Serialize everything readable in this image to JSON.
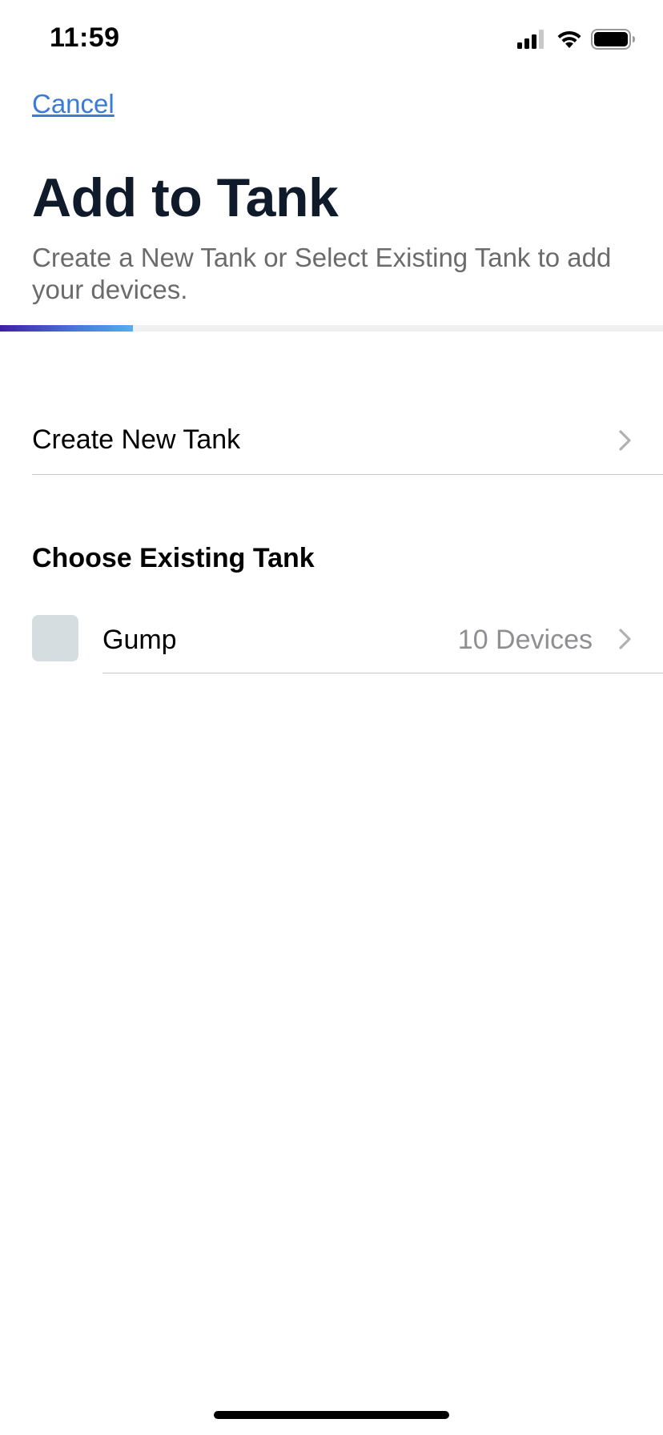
{
  "status_bar": {
    "time": "11:59",
    "icons": [
      "cellular-signal-icon",
      "wifi-icon",
      "battery-icon"
    ]
  },
  "nav": {
    "cancel_label": "Cancel"
  },
  "header": {
    "title": "Add to Tank",
    "subtitle": "Create a New Tank or Select Existing Tank to add your devices."
  },
  "progress": {
    "fraction": 0.2
  },
  "create_row": {
    "label": "Create New Tank",
    "icon": "chevron-right-icon"
  },
  "existing": {
    "section_title": "Choose Existing Tank",
    "tanks": [
      {
        "name": "Gump",
        "device_count": "10 Devices",
        "icon": "chevron-right-icon"
      }
    ]
  },
  "colors": {
    "accent_link": "#3a7bd5",
    "title": "#0f1a2a",
    "subtitle": "#6b6b6b",
    "secondary_text": "#8e8e93",
    "thumb": "#d6dde0",
    "progress_start": "#3f1ea8",
    "progress_end": "#5aaaf0"
  }
}
